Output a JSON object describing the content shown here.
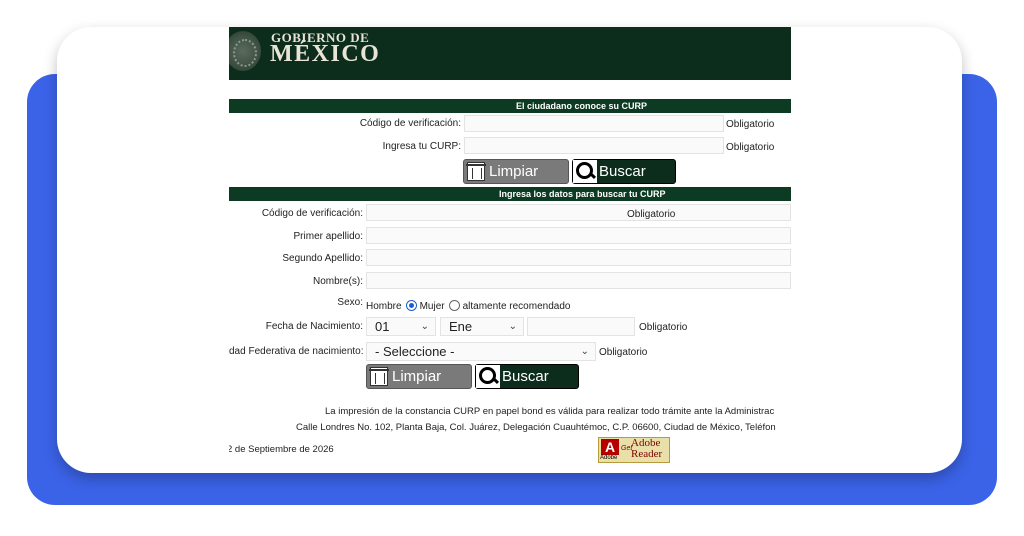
{
  "header": {
    "line1": "GOBIERNO DE",
    "line2": "MÉXICO"
  },
  "section1": {
    "title": "El ciudadano conoce su CURP",
    "verif_label": "Código de verificación:",
    "curp_label": "Ingresa tu CURP:",
    "required": "Obligatorio",
    "clear_label": "Limpiar",
    "search_label": "Buscar"
  },
  "section2": {
    "title": "Ingresa los datos para buscar tu CURP",
    "verif_label": "Código de verificación:",
    "first_surname_label": "Primer apellido:",
    "second_surname_label": "Segundo Apellido:",
    "name_label": "Nombre(s):",
    "sex_label": "Sexo:",
    "sex_male": "Hombre",
    "sex_female": "Mujer",
    "sex_note": "altamente recomendado",
    "sex_selected": "Mujer",
    "birth_label": "Fecha de Nacimiento:",
    "birth_day": "01",
    "birth_month": "Ene",
    "state_label": "dad Federativa de nacimiento:",
    "state_value": "- Seleccione -",
    "required": "Obligatorio",
    "clear_label": "Limpiar",
    "search_label": "Buscar"
  },
  "footer": {
    "notice": "La impresión de la constancia CURP en papel bond es válida para realizar todo trámite ante la Administrac",
    "address": "Calle Londres No. 102, Planta Baja, Col. Juárez, Delegación Cuauhtémoc, C.P. 06600, Ciudad de México, Teléfon",
    "date": "2 de Septiembre de 2026"
  },
  "adobe_badge": {
    "small": "Adobe",
    "get": "Get",
    "line1": "Adobe",
    "line2": "Reader"
  },
  "colors": {
    "blue_backdrop": "#3b63e8",
    "header_green": "#0c2d1c",
    "bar_green": "#0c3a22",
    "radio_blue": "#1a5fd1"
  }
}
